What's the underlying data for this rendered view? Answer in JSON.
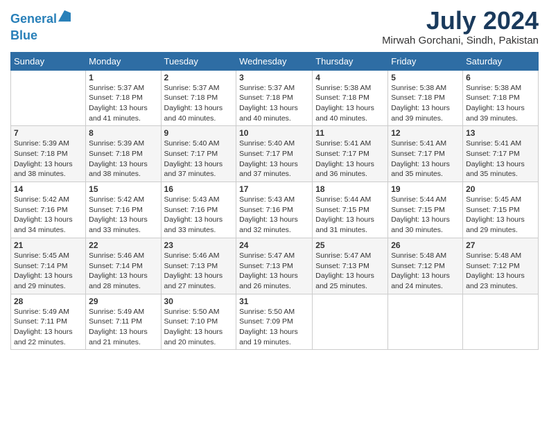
{
  "header": {
    "logo_line1": "General",
    "logo_line2": "Blue",
    "title": "July 2024",
    "location": "Mirwah Gorchani, Sindh, Pakistan"
  },
  "weekdays": [
    "Sunday",
    "Monday",
    "Tuesday",
    "Wednesday",
    "Thursday",
    "Friday",
    "Saturday"
  ],
  "weeks": [
    [
      {
        "day": "",
        "sunrise": "",
        "sunset": "",
        "daylight": ""
      },
      {
        "day": "1",
        "sunrise": "Sunrise: 5:37 AM",
        "sunset": "Sunset: 7:18 PM",
        "daylight": "Daylight: 13 hours and 41 minutes."
      },
      {
        "day": "2",
        "sunrise": "Sunrise: 5:37 AM",
        "sunset": "Sunset: 7:18 PM",
        "daylight": "Daylight: 13 hours and 40 minutes."
      },
      {
        "day": "3",
        "sunrise": "Sunrise: 5:37 AM",
        "sunset": "Sunset: 7:18 PM",
        "daylight": "Daylight: 13 hours and 40 minutes."
      },
      {
        "day": "4",
        "sunrise": "Sunrise: 5:38 AM",
        "sunset": "Sunset: 7:18 PM",
        "daylight": "Daylight: 13 hours and 40 minutes."
      },
      {
        "day": "5",
        "sunrise": "Sunrise: 5:38 AM",
        "sunset": "Sunset: 7:18 PM",
        "daylight": "Daylight: 13 hours and 39 minutes."
      },
      {
        "day": "6",
        "sunrise": "Sunrise: 5:38 AM",
        "sunset": "Sunset: 7:18 PM",
        "daylight": "Daylight: 13 hours and 39 minutes."
      }
    ],
    [
      {
        "day": "7",
        "sunrise": "Sunrise: 5:39 AM",
        "sunset": "Sunset: 7:18 PM",
        "daylight": "Daylight: 13 hours and 38 minutes."
      },
      {
        "day": "8",
        "sunrise": "Sunrise: 5:39 AM",
        "sunset": "Sunset: 7:18 PM",
        "daylight": "Daylight: 13 hours and 38 minutes."
      },
      {
        "day": "9",
        "sunrise": "Sunrise: 5:40 AM",
        "sunset": "Sunset: 7:17 PM",
        "daylight": "Daylight: 13 hours and 37 minutes."
      },
      {
        "day": "10",
        "sunrise": "Sunrise: 5:40 AM",
        "sunset": "Sunset: 7:17 PM",
        "daylight": "Daylight: 13 hours and 37 minutes."
      },
      {
        "day": "11",
        "sunrise": "Sunrise: 5:41 AM",
        "sunset": "Sunset: 7:17 PM",
        "daylight": "Daylight: 13 hours and 36 minutes."
      },
      {
        "day": "12",
        "sunrise": "Sunrise: 5:41 AM",
        "sunset": "Sunset: 7:17 PM",
        "daylight": "Daylight: 13 hours and 35 minutes."
      },
      {
        "day": "13",
        "sunrise": "Sunrise: 5:41 AM",
        "sunset": "Sunset: 7:17 PM",
        "daylight": "Daylight: 13 hours and 35 minutes."
      }
    ],
    [
      {
        "day": "14",
        "sunrise": "Sunrise: 5:42 AM",
        "sunset": "Sunset: 7:16 PM",
        "daylight": "Daylight: 13 hours and 34 minutes."
      },
      {
        "day": "15",
        "sunrise": "Sunrise: 5:42 AM",
        "sunset": "Sunset: 7:16 PM",
        "daylight": "Daylight: 13 hours and 33 minutes."
      },
      {
        "day": "16",
        "sunrise": "Sunrise: 5:43 AM",
        "sunset": "Sunset: 7:16 PM",
        "daylight": "Daylight: 13 hours and 33 minutes."
      },
      {
        "day": "17",
        "sunrise": "Sunrise: 5:43 AM",
        "sunset": "Sunset: 7:16 PM",
        "daylight": "Daylight: 13 hours and 32 minutes."
      },
      {
        "day": "18",
        "sunrise": "Sunrise: 5:44 AM",
        "sunset": "Sunset: 7:15 PM",
        "daylight": "Daylight: 13 hours and 31 minutes."
      },
      {
        "day": "19",
        "sunrise": "Sunrise: 5:44 AM",
        "sunset": "Sunset: 7:15 PM",
        "daylight": "Daylight: 13 hours and 30 minutes."
      },
      {
        "day": "20",
        "sunrise": "Sunrise: 5:45 AM",
        "sunset": "Sunset: 7:15 PM",
        "daylight": "Daylight: 13 hours and 29 minutes."
      }
    ],
    [
      {
        "day": "21",
        "sunrise": "Sunrise: 5:45 AM",
        "sunset": "Sunset: 7:14 PM",
        "daylight": "Daylight: 13 hours and 29 minutes."
      },
      {
        "day": "22",
        "sunrise": "Sunrise: 5:46 AM",
        "sunset": "Sunset: 7:14 PM",
        "daylight": "Daylight: 13 hours and 28 minutes."
      },
      {
        "day": "23",
        "sunrise": "Sunrise: 5:46 AM",
        "sunset": "Sunset: 7:13 PM",
        "daylight": "Daylight: 13 hours and 27 minutes."
      },
      {
        "day": "24",
        "sunrise": "Sunrise: 5:47 AM",
        "sunset": "Sunset: 7:13 PM",
        "daylight": "Daylight: 13 hours and 26 minutes."
      },
      {
        "day": "25",
        "sunrise": "Sunrise: 5:47 AM",
        "sunset": "Sunset: 7:13 PM",
        "daylight": "Daylight: 13 hours and 25 minutes."
      },
      {
        "day": "26",
        "sunrise": "Sunrise: 5:48 AM",
        "sunset": "Sunset: 7:12 PM",
        "daylight": "Daylight: 13 hours and 24 minutes."
      },
      {
        "day": "27",
        "sunrise": "Sunrise: 5:48 AM",
        "sunset": "Sunset: 7:12 PM",
        "daylight": "Daylight: 13 hours and 23 minutes."
      }
    ],
    [
      {
        "day": "28",
        "sunrise": "Sunrise: 5:49 AM",
        "sunset": "Sunset: 7:11 PM",
        "daylight": "Daylight: 13 hours and 22 minutes."
      },
      {
        "day": "29",
        "sunrise": "Sunrise: 5:49 AM",
        "sunset": "Sunset: 7:11 PM",
        "daylight": "Daylight: 13 hours and 21 minutes."
      },
      {
        "day": "30",
        "sunrise": "Sunrise: 5:50 AM",
        "sunset": "Sunset: 7:10 PM",
        "daylight": "Daylight: 13 hours and 20 minutes."
      },
      {
        "day": "31",
        "sunrise": "Sunrise: 5:50 AM",
        "sunset": "Sunset: 7:09 PM",
        "daylight": "Daylight: 13 hours and 19 minutes."
      },
      {
        "day": "",
        "sunrise": "",
        "sunset": "",
        "daylight": ""
      },
      {
        "day": "",
        "sunrise": "",
        "sunset": "",
        "daylight": ""
      },
      {
        "day": "",
        "sunrise": "",
        "sunset": "",
        "daylight": ""
      }
    ]
  ]
}
